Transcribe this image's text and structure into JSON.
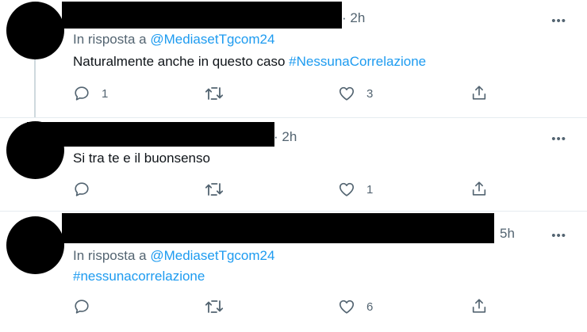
{
  "colors": {
    "link": "#1d9bf0",
    "secondary_text": "#536471",
    "primary_text": "#0f1419",
    "divider": "#e6ecf0",
    "redaction": "#000000"
  },
  "icons": {
    "reply": "reply-icon",
    "retweet": "retweet-icon",
    "like": "heart-icon",
    "share": "share-icon",
    "more": "more-icon"
  },
  "tweets": [
    {
      "time": "· 2h",
      "more": "•••",
      "reply_to_prefix": "In risposta a ",
      "reply_to_handle": "@MediasetTgcom24",
      "text_plain": "Naturalmente anche in questo caso ",
      "text_hashtag": "#NessunaCorrelazione",
      "reply_count": "1",
      "retweet_count": "",
      "like_count": "3"
    },
    {
      "time": "· 2h",
      "more": "•••",
      "text_plain": "Si tra te e il buonsenso",
      "reply_count": "",
      "retweet_count": "",
      "like_count": "1"
    },
    {
      "time": "5h",
      "more": "•••",
      "reply_to_prefix": "In risposta a ",
      "reply_to_handle": "@MediasetTgcom24",
      "text_hashtag": "#nessunacorrelazione",
      "reply_count": "",
      "retweet_count": "",
      "like_count": "6"
    }
  ]
}
